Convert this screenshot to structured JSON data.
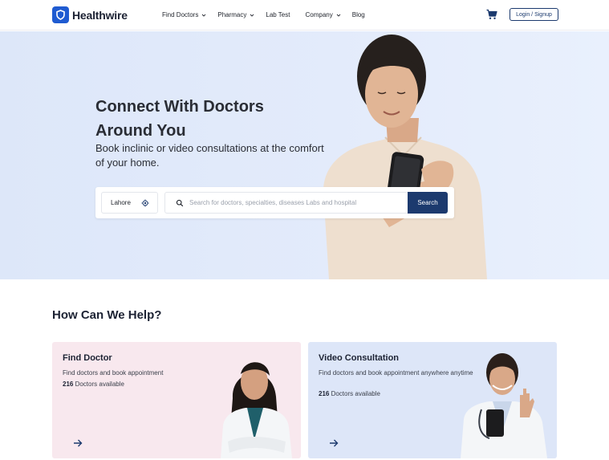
{
  "header": {
    "brand": "Healthwire",
    "nav": [
      {
        "label": "Find Doctors",
        "has_dropdown": true
      },
      {
        "label": "Pharmacy",
        "has_dropdown": true
      },
      {
        "label": "Lab Test",
        "has_dropdown": false
      },
      {
        "label": "Company",
        "has_dropdown": true
      },
      {
        "label": "Blog",
        "has_dropdown": false
      }
    ],
    "cart_icon": "cart-icon",
    "login_label": "Login / Signup"
  },
  "hero": {
    "title_line1": "Connect With Doctors",
    "title_line2": "Around You",
    "subtitle": "Book inclinic or video consultations at the comfort of your home.",
    "search": {
      "city": "Lahore",
      "placeholder": "Search for doctors, specialties, diseases Labs  and hospital",
      "button": "Search"
    }
  },
  "help": {
    "title": "How Can We Help?",
    "cards": [
      {
        "title": "Find Doctor",
        "description": "Find doctors and book appointment",
        "count": "216",
        "count_suffix": " Doctors available"
      },
      {
        "title": "Video Consultation",
        "description": "Find doctors and book appointment anywhere anytime",
        "count": "216",
        "count_suffix": " Doctors available"
      }
    ]
  },
  "colors": {
    "brand_blue": "#1f5bd1",
    "navy": "#1c3a6e",
    "hero_bg": "#e3ebfb",
    "card_pink": "#f8e8ee",
    "card_blue": "#dde6f8"
  }
}
